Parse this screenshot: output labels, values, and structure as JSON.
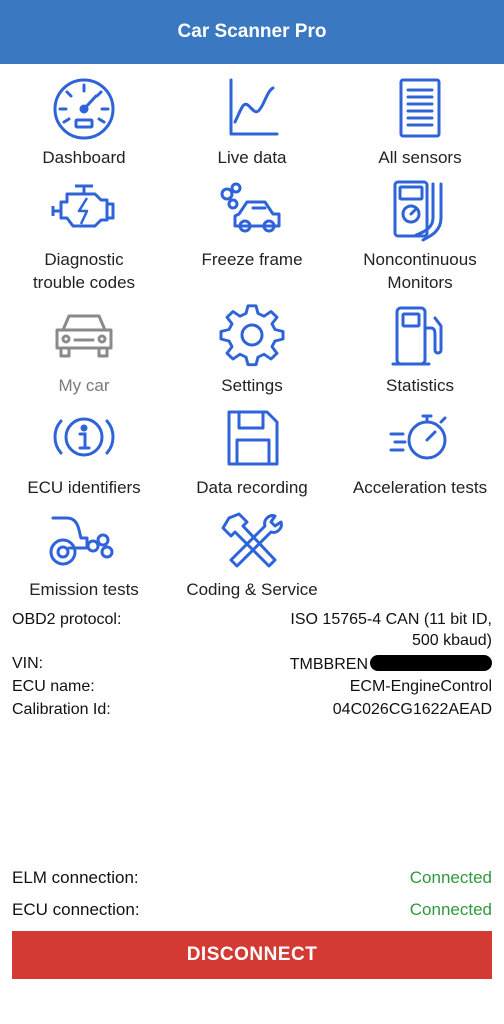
{
  "header": {
    "title": "Car Scanner Pro"
  },
  "menu": {
    "dashboard": "Dashboard",
    "live_data": "Live data",
    "all_sensors": "All sensors",
    "dtc": "Diagnostic\ntrouble codes",
    "freeze_frame": "Freeze frame",
    "noncontinuous": "Noncontinuous\nMonitors",
    "my_car": "My car",
    "settings": "Settings",
    "statistics": "Statistics",
    "ecu_identifiers": "ECU identifiers",
    "data_recording": "Data recording",
    "acceleration_tests": "Acceleration tests",
    "emission_tests": "Emission tests",
    "coding_service": "Coding & Service"
  },
  "info": {
    "protocol_label": "OBD2 protocol:",
    "protocol_value_1": "ISO 15765-4 CAN (11 bit ID,",
    "protocol_value_2": "500 kbaud)",
    "vin_label": "VIN:",
    "vin_value": "TMBBREN",
    "ecu_name_label": "ECU name:",
    "ecu_name_value": "ECM-EngineControl",
    "calibration_label": "Calibration Id:",
    "calibration_value": "04C026CG1622AEAD"
  },
  "connection": {
    "elm_label": "ELM connection:",
    "elm_status": "Connected",
    "ecu_label": "ECU connection:",
    "ecu_status": "Connected"
  },
  "actions": {
    "disconnect": "DISCONNECT"
  },
  "colors": {
    "accent": "#3a78c2",
    "icon_blue": "#2f63d8",
    "connected": "#2f9a3c",
    "disconnect": "#d33a33",
    "disabled": "#8a8a8a"
  }
}
